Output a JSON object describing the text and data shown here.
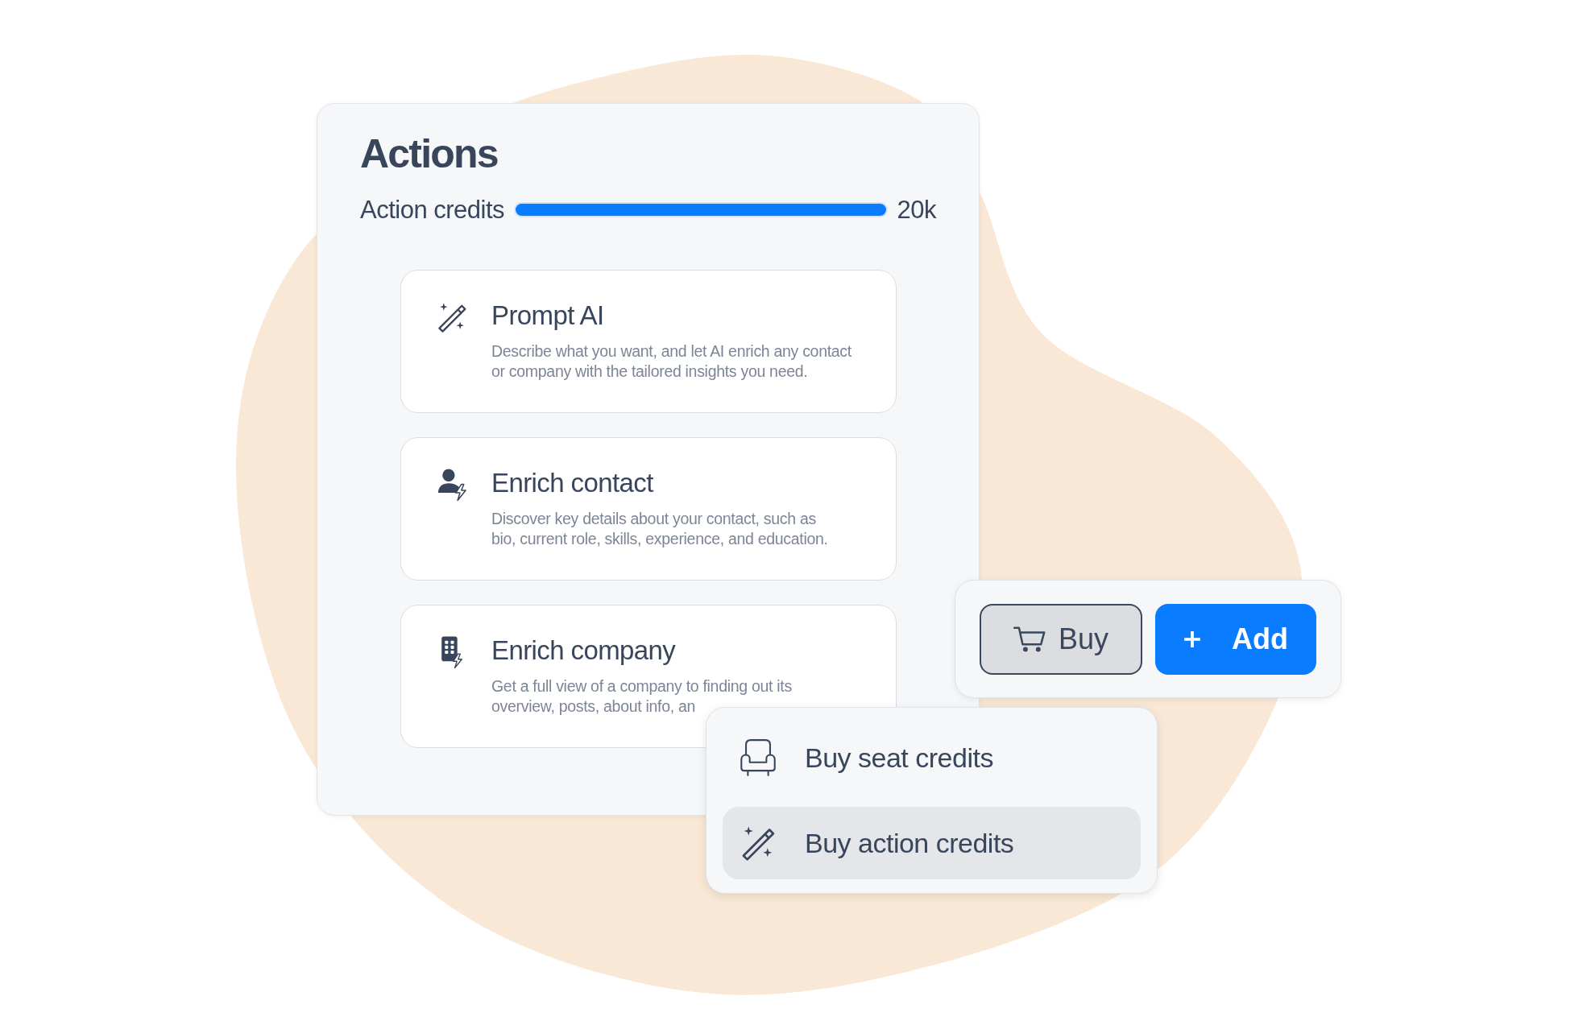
{
  "actions_panel": {
    "title": "Actions",
    "credits": {
      "label": "Action credits",
      "level": 1,
      "reading": "20k"
    },
    "cards": [
      {
        "kind": "wand",
        "title": "Prompt AI",
        "description": [
          "Describe what you want, and let AI enrich any contact",
          "or company with the tailored insights you need."
        ]
      },
      {
        "kind": "contact",
        "title": "Enrich contact",
        "description": [
          "Discover key details about your contact, such as",
          "bio, current role, skills, experience, and education."
        ]
      },
      {
        "kind": "company",
        "title": "Enrich company",
        "description": [
          "Get a full view of a company to finding out its",
          "overview, posts, about info, an"
        ]
      }
    ]
  },
  "buy_panel": {
    "buttons": [
      {
        "kind": "outline",
        "label": "Buy"
      },
      {
        "kind": "primary",
        "label": "Add"
      }
    ]
  },
  "menu": {
    "items": [
      {
        "kind": "seat",
        "label": "Buy seat credits",
        "selected": false
      },
      {
        "kind": "wand",
        "label": "Buy action credits",
        "selected": true
      }
    ]
  }
}
